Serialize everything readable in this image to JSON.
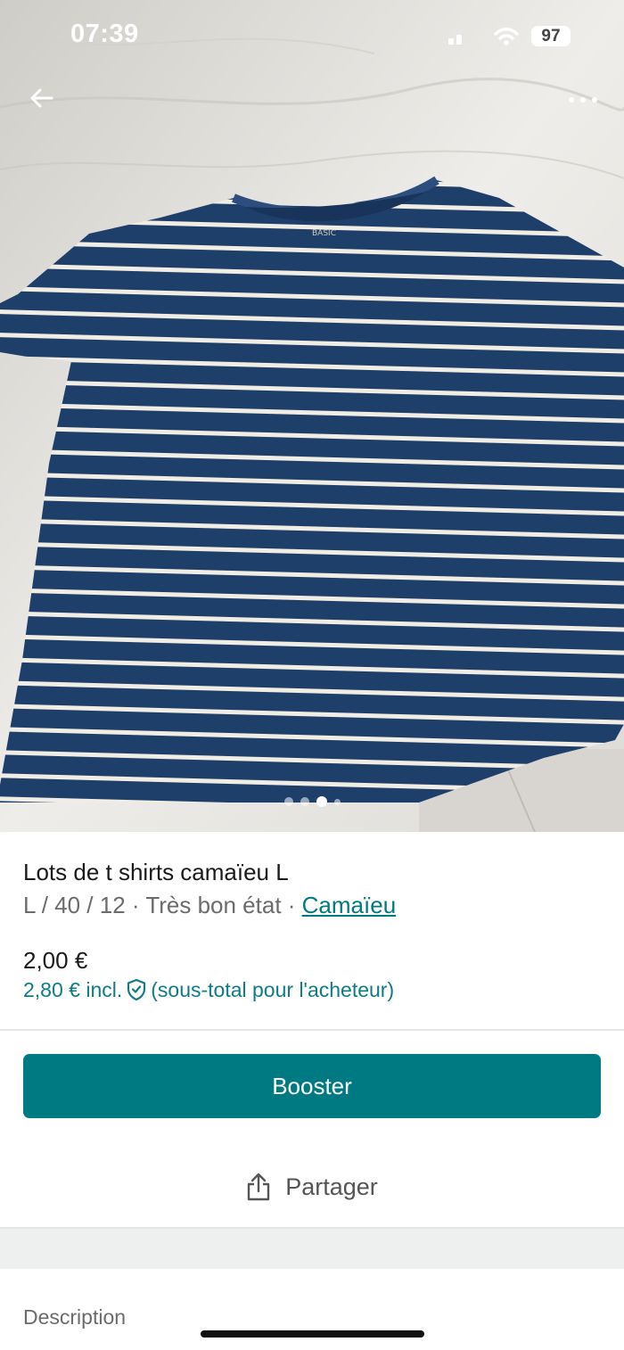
{
  "status": {
    "time": "07:39",
    "battery": "97"
  },
  "nav": {
    "back_icon": "arrow-left-icon",
    "more_icon": "more-horizontal-icon"
  },
  "gallery": {
    "image_count": 4,
    "active_index": 2
  },
  "item": {
    "title": "Lots de t shirts camaïeu L",
    "details": "L / 40 / 12 · Très bon état · ",
    "brand": "Camaïeu",
    "price": "2,00 €",
    "price_incl": "2,80 € incl.",
    "price_incl_note": "(sous-total pour l'acheteur)",
    "shield_icon": "shield-check-icon"
  },
  "actions": {
    "booster_label": "Booster",
    "share_label": "Partager",
    "share_icon": "share-icon"
  },
  "sections": {
    "description_label": "Description"
  },
  "colors": {
    "accent": "#007a82",
    "shirt": "#1f3f6b",
    "stripe": "#f1ede4"
  }
}
